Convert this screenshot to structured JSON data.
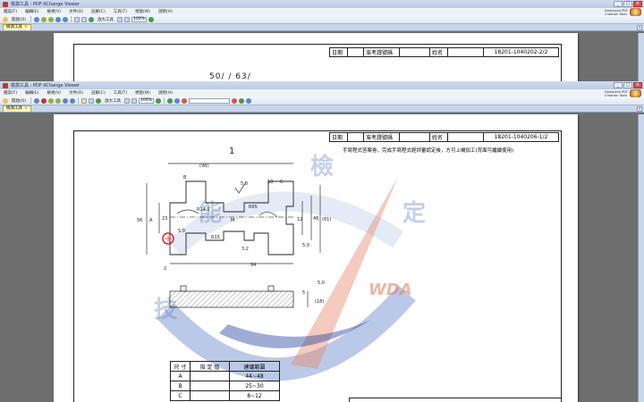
{
  "window": {
    "title": "檢測工具 - PDF-XChange Viewer",
    "controls": [
      "_",
      "□",
      "×"
    ],
    "logo_note": "Download PDF\nCreation Tools"
  },
  "menu": [
    "檔案(F)",
    "編輯(E)",
    "檢視(V)",
    "文件(D)",
    "註解(C)",
    "工具(T)",
    "視窗(W)",
    "說明(H)"
  ],
  "toolbar": {
    "open_label": "開啟(O)",
    "zoom_tool_label": "放大工具",
    "zoom_value": "100%"
  },
  "tab": {
    "label": "檢測工具"
  },
  "back_page": {
    "header": {
      "date_label": "日期",
      "exam_no_label": "准考證號碼",
      "name_label": "姓名",
      "doc_code": "18201-1040202-2/2"
    },
    "fragment": "50/ / 63/"
  },
  "front_page": {
    "header": {
      "date_label": "日期",
      "exam_no_label": "准考證號碼",
      "name_label": "姓名",
      "doc_code": "18201-1040206-1/2"
    },
    "notice": "手寫程式答案卷，完成手寫程式經評審認定後，方可上機加工(背面可繼續使用)",
    "drawing": {
      "view_number": "1",
      "dims": {
        "overall_length": "(98)",
        "top_B": "B",
        "top_10": "10",
        "top_C": "C",
        "roughness_1": "5.0",
        "roughness_2": "5.0",
        "roughness_3": "5.0",
        "roughness_4": "3.2",
        "roughness_5": "5.0",
        "roughness_6": "3.2",
        "r_left": "R14.5",
        "r_right": "R65",
        "m_center": "M",
        "r_bottom": "R15",
        "dim_A": "A",
        "dim_56": "56",
        "dim_23": "23",
        "dim_12": "12",
        "dim_46": "46",
        "dim_61": "(61)",
        "dim_2": "2",
        "dim_94": "94",
        "dim_5": "5",
        "dim_18": "(18)"
      }
    },
    "watermark": {
      "chars": [
        "檢",
        "能",
        "定",
        "技"
      ],
      "brand": "WDA"
    },
    "dim_table": {
      "headers": [
        "尺 寸",
        "指 定 值",
        "建議範圍"
      ],
      "rows": [
        [
          "A",
          "",
          "44~48"
        ],
        [
          "B",
          "",
          "25~30"
        ],
        [
          "C",
          "",
          "8~12"
        ]
      ]
    }
  },
  "colors": {
    "page_bg": "#6e6e6e",
    "accent_blue": "#2c5aa0",
    "watermark_orange": "#e07a5a",
    "marker_red": "#e0141e"
  }
}
